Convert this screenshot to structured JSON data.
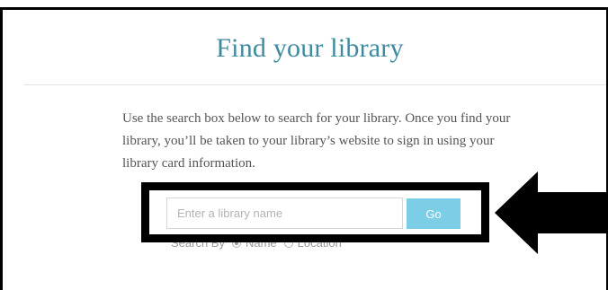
{
  "page": {
    "title": "Find your library",
    "instructions": "Use the search box below to search for your library. Once you find your library, you’ll be taken to your library’s website to sign in using your library card information."
  },
  "search": {
    "placeholder": "Enter a library name",
    "value": "",
    "go_label": "Go",
    "search_by_label": "Search By",
    "options": [
      {
        "label": "Name",
        "selected": true
      },
      {
        "label": "Location",
        "selected": false
      }
    ]
  },
  "colors": {
    "title": "#3f8a9f",
    "go_button": "#7ccde6",
    "highlight": "#000000"
  },
  "icons": {
    "pointer": "left-arrow-icon"
  }
}
